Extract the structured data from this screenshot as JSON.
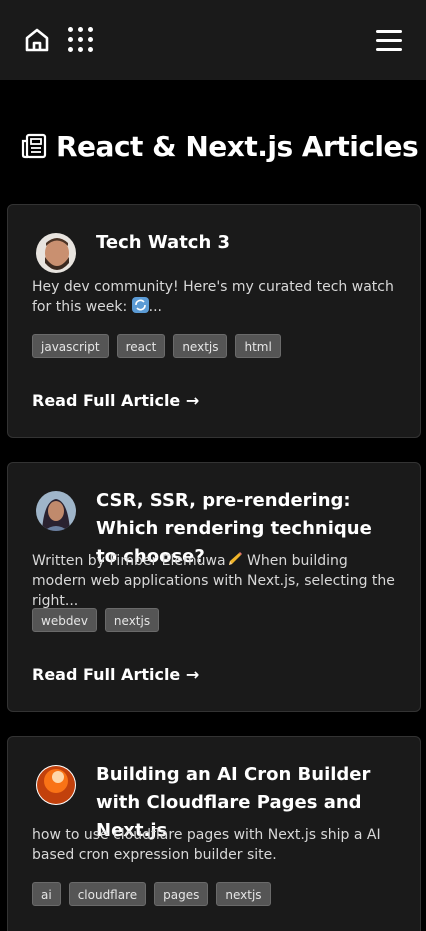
{
  "header": {
    "icons": [
      "home-icon",
      "apps-grid-icon",
      "hamburger-menu-icon"
    ]
  },
  "page": {
    "title": "React & Next.js Articles",
    "title_icon": "newspaper-icon"
  },
  "articles": [
    {
      "title": "Tech Watch 3",
      "excerpt_before": "Hey dev community! Here's my curated tech watch for this week: ",
      "excerpt_emoji": "cycle-arrows-emoji",
      "excerpt_after": "...",
      "tags": [
        "javascript",
        "react",
        "nextjs",
        "html"
      ],
      "cta": "Read Full Article →",
      "avatar": "author-avatar-bearded-man"
    },
    {
      "title": "CSR, SSR, pre-rendering: Which rendering technique to choose?",
      "excerpt_before": "Written by Fimber Elemuwa",
      "excerpt_emoji": "pencil-emoji",
      "excerpt_after": " When building modern web applications with Next.js, selecting the right...",
      "tags": [
        "webdev",
        "nextjs"
      ],
      "cta": "Read Full Article →",
      "avatar": "author-avatar-woman"
    },
    {
      "title": "Building an AI Cron Builder with Cloudflare Pages and Next.js",
      "excerpt_before": "how to use cloudflare pages with Next.js ship a AI based cron expression builder site.",
      "tags": [
        "ai",
        "cloudflare",
        "pages",
        "nextjs"
      ],
      "avatar": "author-avatar-orange-sphere"
    }
  ],
  "colors": {
    "background": "#000000",
    "header": "#1a1a1a",
    "card": "#1a1a1a",
    "tag": "#555555"
  }
}
